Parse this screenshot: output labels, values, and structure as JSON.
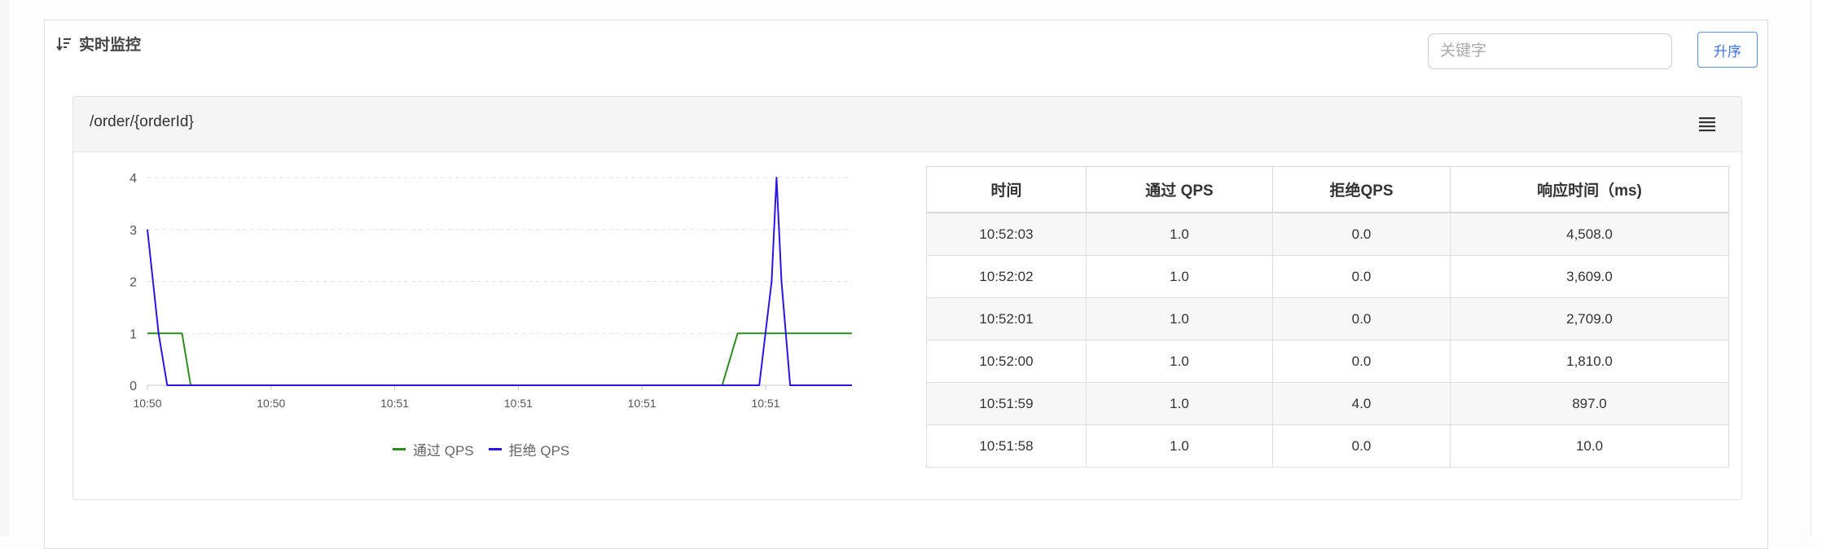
{
  "header": {
    "title": "实时监控",
    "search_placeholder": "关键字",
    "sort_label": "升序"
  },
  "card": {
    "title": "/order/{orderId}"
  },
  "chart_data": {
    "type": "line",
    "y_ticks": [
      "0",
      "1",
      "2",
      "3",
      "4"
    ],
    "ylim": [
      0,
      4
    ],
    "x_tick_labels": [
      "10:50",
      "10:50",
      "10:51",
      "10:51",
      "10:51",
      "10:51"
    ],
    "legend_position": "bottom",
    "grid": true,
    "series": [
      {
        "name": "通过 QPS",
        "color": "#2e8b1f",
        "points": [
          [
            0,
            1
          ],
          [
            0.5,
            1
          ],
          [
            0.56,
            1
          ],
          [
            0.7,
            0
          ],
          [
            1.0,
            0
          ],
          [
            9.3,
            0
          ],
          [
            9.55,
            1
          ],
          [
            9.7,
            1
          ],
          [
            10.1,
            1
          ],
          [
            11.4,
            1
          ]
        ]
      },
      {
        "name": "拒绝 QPS",
        "color": "#2a16e0",
        "points": [
          [
            0,
            3
          ],
          [
            0.18,
            1
          ],
          [
            0.32,
            0
          ],
          [
            1.0,
            0
          ],
          [
            9.9,
            0
          ],
          [
            10.1,
            2
          ],
          [
            10.18,
            4
          ],
          [
            10.26,
            2
          ],
          [
            10.4,
            0
          ],
          [
            11.4,
            0
          ]
        ]
      }
    ]
  },
  "table": {
    "columns": [
      "时间",
      "通过 QPS",
      "拒绝QPS",
      "响应时间（ms)"
    ],
    "rows": [
      [
        "10:52:03",
        "1.0",
        "0.0",
        "4,508.0"
      ],
      [
        "10:52:02",
        "1.0",
        "0.0",
        "3,609.0"
      ],
      [
        "10:52:01",
        "1.0",
        "0.0",
        "2,709.0"
      ],
      [
        "10:52:00",
        "1.0",
        "0.0",
        "1,810.0"
      ],
      [
        "10:51:59",
        "1.0",
        "4.0",
        "897.0"
      ],
      [
        "10:51:58",
        "1.0",
        "0.0",
        "10.0"
      ]
    ]
  }
}
